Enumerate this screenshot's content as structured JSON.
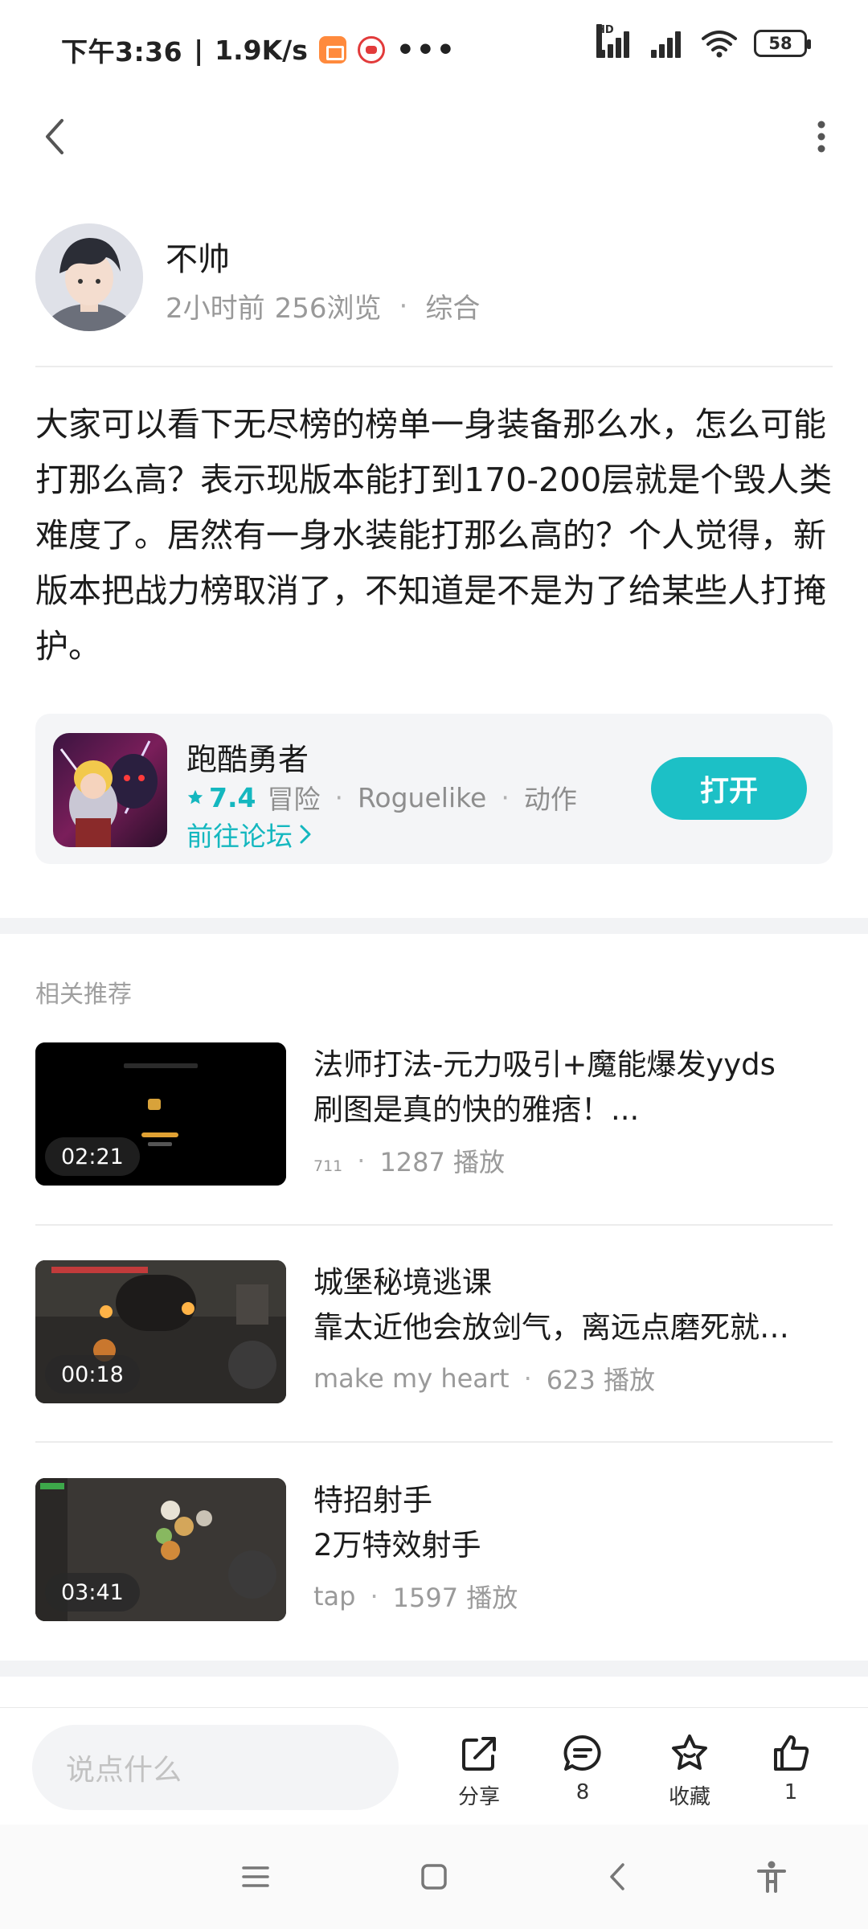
{
  "status_bar": {
    "time": "下午3:36",
    "separator": "|",
    "net_speed": "1.9K/s",
    "more": "•••",
    "hd_label": "HD",
    "battery": "58"
  },
  "author": {
    "name": "不帅",
    "time_ago": "2小时前",
    "views": "256浏览",
    "dot": "·",
    "category": "综合"
  },
  "post": {
    "body": "大家可以看下无尽榜的榜单一身装备那么水，怎么可能打那么高？表示现版本能打到170-200层就是个毁人类难度了。居然有一身水装能打那么高的？个人觉得，新版本把战力榜取消了，不知道是不是为了给某些人打掩护。"
  },
  "game_card": {
    "name": "跑酷勇者",
    "rating": "7.4",
    "tags": [
      "冒险",
      "Roguelike",
      "动作"
    ],
    "dot": "·",
    "forum_link": "前往论坛",
    "open_label": "打开"
  },
  "related": {
    "title": "相关推荐",
    "items": [
      {
        "title1": "法师打法-元力吸引+魔能爆发yyds",
        "title2": "刷图是真的快的雅痞！...",
        "author": "711",
        "plays": "1287 播放",
        "duration": "02:21"
      },
      {
        "title1": "城堡秘境逃课",
        "title2": "靠太近他会放剑气，离远点磨死就…",
        "author": "make my heart",
        "plays": "623 播放",
        "duration": "00:18"
      },
      {
        "title1": "特招射手",
        "title2": "2万特效射手",
        "author": "tap",
        "plays": "1597 播放",
        "duration": "03:41"
      }
    ],
    "dot": "·"
  },
  "bottom_bar": {
    "comment_placeholder": "说点什么",
    "share_label": "分享",
    "comment_count": "8",
    "favorite_label": "收藏",
    "like_count": "1"
  },
  "colors": {
    "accent": "#1cc0c6",
    "accent_text": "#14b7bf",
    "muted": "#999999"
  },
  "icons": [
    "back-icon",
    "more-vertical-icon",
    "star-icon",
    "chevron-right-icon",
    "share-icon",
    "comment-icon",
    "favorite-icon",
    "like-icon",
    "menu-icon",
    "home-icon",
    "back-nav-icon",
    "accessibility-icon"
  ]
}
